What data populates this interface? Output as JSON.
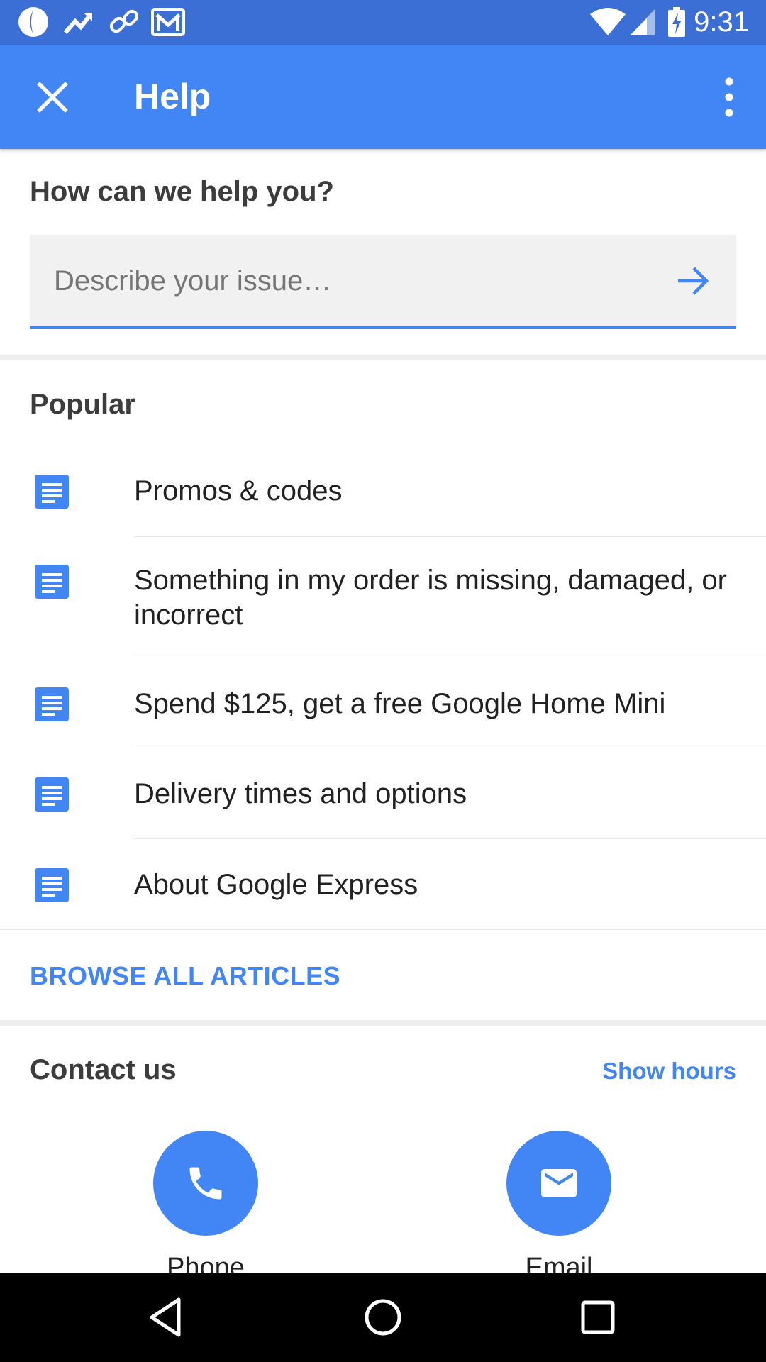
{
  "status_bar": {
    "time": "9:31",
    "left_icons": [
      "drop-icon",
      "trending-icon",
      "link-icon",
      "gmail-icon"
    ],
    "right_icons": [
      "wifi-icon",
      "signal-icon",
      "battery-charging-icon"
    ]
  },
  "app_bar": {
    "title": "Help",
    "close_icon": "close-icon",
    "menu_icon": "more-vert-icon"
  },
  "help": {
    "heading": "How can we help you?",
    "search_placeholder": "Describe your issue…",
    "search_value": ""
  },
  "popular": {
    "heading": "Popular",
    "items": [
      {
        "label": "Promos & codes",
        "icon": "article-icon"
      },
      {
        "label": "Something in my order is missing, damaged, or incorrect",
        "icon": "article-icon"
      },
      {
        "label": "Spend $125, get a free Google Home Mini",
        "icon": "article-icon"
      },
      {
        "label": "Delivery times and options",
        "icon": "article-icon"
      },
      {
        "label": "About Google Express",
        "icon": "article-icon"
      }
    ],
    "browse_all": "BROWSE ALL ARTICLES"
  },
  "contact": {
    "heading": "Contact us",
    "show_hours": "Show hours",
    "options": [
      {
        "label": "Phone",
        "icon": "phone-icon"
      },
      {
        "label": "Email",
        "icon": "email-icon"
      }
    ]
  },
  "nav_bar": {
    "icons": [
      "back-icon",
      "home-icon",
      "recents-icon"
    ]
  },
  "colors": {
    "primary": "#4285f4",
    "status_bar": "#3b6fd6",
    "text_dark": "#212121",
    "divider": "#e6e6e6"
  }
}
